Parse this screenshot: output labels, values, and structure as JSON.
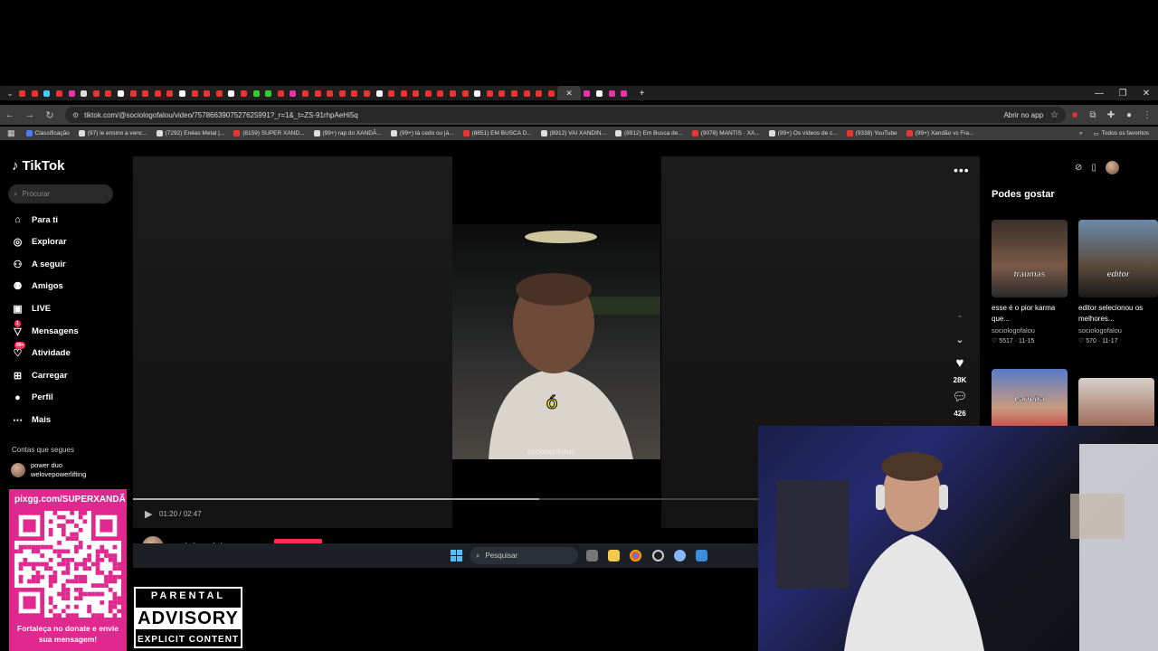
{
  "browser": {
    "url": "tiktok.com/@sociologofalou/video/7578663907527625991?_r=1&_t=ZS-91rhpAeHi5q",
    "open_in_app": "Abrir no app",
    "bookmarks": [
      "Classificação",
      "(97) le ensino a venc...",
      "(7292) Enéas Metal |...",
      "(8159) SUPER XAND...",
      "(99+) rap do XANDÃ...",
      "(99+) tá cedo ou já...",
      "(8851) EM BUSCA D...",
      "(8912) VAI XANDIN...",
      "(8912) Em Busca de...",
      "(9078) MANTIS · XA...",
      "(99+) Os vídeos de c...",
      "(9338) YouTube",
      "(99+) Xandão vs Fra..."
    ],
    "all_bookmarks": "Todos os favoritos"
  },
  "tiktok": {
    "logo": "TikTok",
    "search_placeholder": "Procurar",
    "nav": [
      {
        "label": "Para ti",
        "icon": "home-icon"
      },
      {
        "label": "Explorar",
        "icon": "compass-icon"
      },
      {
        "label": "A seguir",
        "icon": "following-icon"
      },
      {
        "label": "Amigos",
        "icon": "friends-icon"
      },
      {
        "label": "LIVE",
        "icon": "live-icon"
      },
      {
        "label": "Mensagens",
        "icon": "messages-icon",
        "badge": "1"
      },
      {
        "label": "Atividade",
        "icon": "activity-icon",
        "badge": "99+"
      },
      {
        "label": "Carregar",
        "icon": "upload-icon"
      },
      {
        "label": "Perfil",
        "icon": "profile-icon"
      },
      {
        "label": "Mais",
        "icon": "more-icon"
      }
    ],
    "following_title": "Contas que segues",
    "following": [
      {
        "name": "power duo welovepowerlifting"
      }
    ]
  },
  "player": {
    "caption": "ó",
    "watermark": "sociologofalou",
    "likes": "28K",
    "comments": "426",
    "time": "01:20 / 02:47",
    "progress": 0.65,
    "author": "sociologofalou"
  },
  "rail": {
    "title": "Podes gostar",
    "cards": [
      {
        "word": "traumas",
        "title": "esse é o pior karma que...",
        "user": "sociologofalou",
        "stats": "♡ 5517 · 11-15"
      },
      {
        "word": "editor",
        "title": "editor selecionou os melhores...",
        "user": "sociologofalou",
        "stats": "♡ 570 · 11-17"
      },
      {
        "word": "carreira",
        "title": "",
        "user": "",
        "stats": ""
      },
      {
        "word": "",
        "title": "",
        "user": "",
        "stats": ""
      }
    ]
  },
  "taskbar": {
    "search_placeholder": "Pesquisar"
  },
  "overlay": {
    "qr_url": "pixgg.com/SUPERXANDÃ",
    "qr_message": "Fortaleça no donate e envie sua mensagem!",
    "pa_line1": "PARENTAL",
    "pa_line2": "ADVISORY",
    "pa_line3": "EXPLICIT CONTENT"
  },
  "colors": {
    "accent": "#fe2c55",
    "caption": "#ffe000",
    "qr_bg": "#e0288f"
  }
}
